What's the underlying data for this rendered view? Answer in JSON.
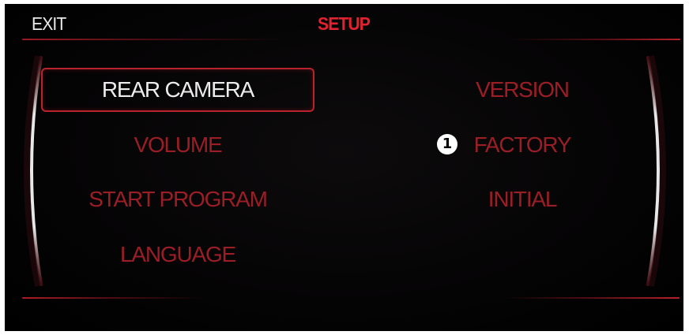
{
  "header": {
    "exit_label": "EXIT",
    "title": "SETUP"
  },
  "left_menu": [
    {
      "label": "REAR CAMERA",
      "selected": true
    },
    {
      "label": "VOLUME",
      "selected": false
    },
    {
      "label": "START PROGRAM",
      "selected": false
    },
    {
      "label": "LANGUAGE",
      "selected": false
    }
  ],
  "right_menu": [
    {
      "label": "VERSION"
    },
    {
      "label": "FACTORY"
    },
    {
      "label": "INITIAL"
    }
  ],
  "callout": {
    "label": "1"
  },
  "colors": {
    "background": "#000000",
    "accent_red": "#e0232e",
    "menu_red": "#9a1e26",
    "selected_text": "#ececec",
    "highlight_border": "#b8232d"
  }
}
